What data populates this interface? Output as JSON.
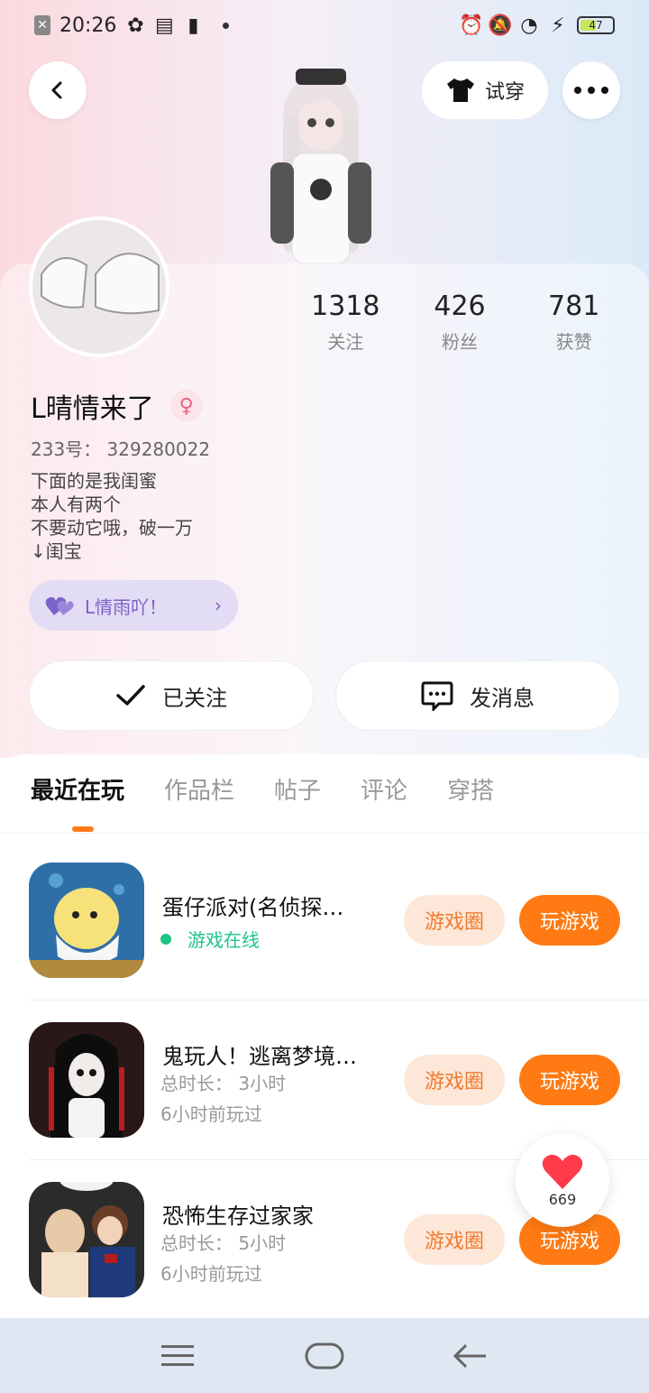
{
  "status_bar": {
    "time": "20:26",
    "battery": "47"
  },
  "header": {
    "tryon_label": "试穿"
  },
  "profile": {
    "stats": [
      {
        "value": "1318",
        "label": "关注"
      },
      {
        "value": "426",
        "label": "粉丝"
      },
      {
        "value": "781",
        "label": "获赞"
      }
    ],
    "username": "L晴情来了",
    "gender_symbol": "♀",
    "uid": "233号： 329280022",
    "bio": [
      "下面的是我闺蜜",
      "本人有两个",
      "不要动它哦，破一万",
      "↓闺宝"
    ],
    "bff_label": "L情雨吖！",
    "following_label": "已关注",
    "message_label": "发消息"
  },
  "tabs": [
    "最近在玩",
    "作品栏",
    "帖子",
    "评论",
    "穿搭"
  ],
  "games": [
    {
      "title": "蛋仔派对(名侦探…",
      "status": "游戏在线",
      "circle_label": "游戏圈",
      "play_label": "玩游戏"
    },
    {
      "title": "鬼玩人！逃离梦境…",
      "duration": "总时长： 3小时",
      "last_played": "6小时前玩过",
      "circle_label": "游戏圈",
      "play_label": "玩游戏"
    },
    {
      "title": "恐怖生存过家家",
      "duration": "总时长： 5小时",
      "last_played": "6小时前玩过",
      "circle_label": "游戏圈",
      "play_label": "玩游戏"
    }
  ],
  "like_float": {
    "count": "669"
  },
  "colors": {
    "accent": "#ff7a12",
    "online": "#1ec386",
    "bff": "#7b63c8"
  }
}
